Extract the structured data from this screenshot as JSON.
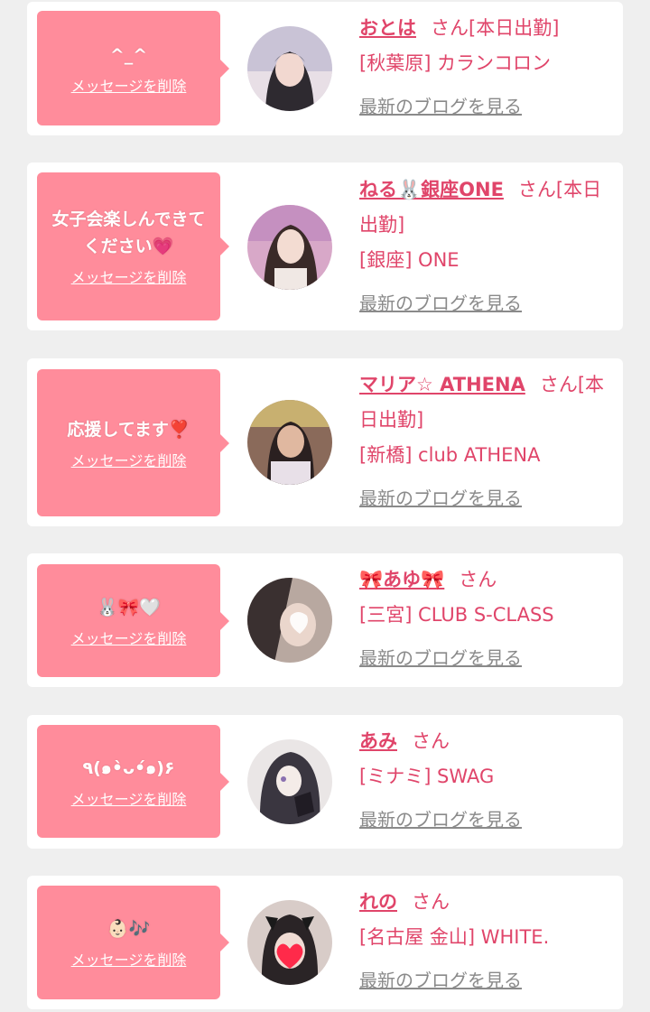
{
  "cards": [
    {
      "message": "^_^",
      "delete_label": "メッセージを削除",
      "name": "おとは",
      "honorific": "さん[本日出勤]",
      "shop": "[秋葉原] カランコロン",
      "blog_label": "最新のブログを見る",
      "avatar_color": "#c9c3d6"
    },
    {
      "message": "女子会楽しんできてください💗",
      "delete_label": "メッセージを削除",
      "name": "ねる🐰銀座ONE",
      "honorific": "さん[本日出勤]",
      "shop": "[銀座] ONE",
      "blog_label": "最新のブログを見る",
      "avatar_color": "#d8a8c8"
    },
    {
      "message": "応援してます❣️",
      "delete_label": "メッセージを削除",
      "name": "マリア☆ ATHENA",
      "honorific": "さん[本日出勤]",
      "shop": "[新橋] club ATHENA",
      "blog_label": "最新のブログを見る",
      "avatar_color": "#8a6a5a"
    },
    {
      "message": "🐰🎀🤍",
      "delete_label": "メッセージを削除",
      "name": "🎀あゆ🎀",
      "honorific": "さん",
      "shop": "[三宮] CLUB S-CLASS",
      "blog_label": "最新のブログを見る",
      "avatar_color": "#b8a8a0"
    },
    {
      "message": "٩(๑•̀ᴗ•́๑)۶",
      "delete_label": "メッセージを削除",
      "name": "あみ",
      "honorific": "さん",
      "shop": "[ミナミ] SWAG",
      "blog_label": "最新のブログを見る",
      "avatar_color": "#5a5560"
    },
    {
      "message": "👶🏻🎶",
      "delete_label": "メッセージを削除",
      "name": "れの",
      "honorific": "さん",
      "shop": "[名古屋 金山] WHITE.",
      "blog_label": "最新のブログを見る",
      "avatar_color": "#3a3030"
    }
  ]
}
